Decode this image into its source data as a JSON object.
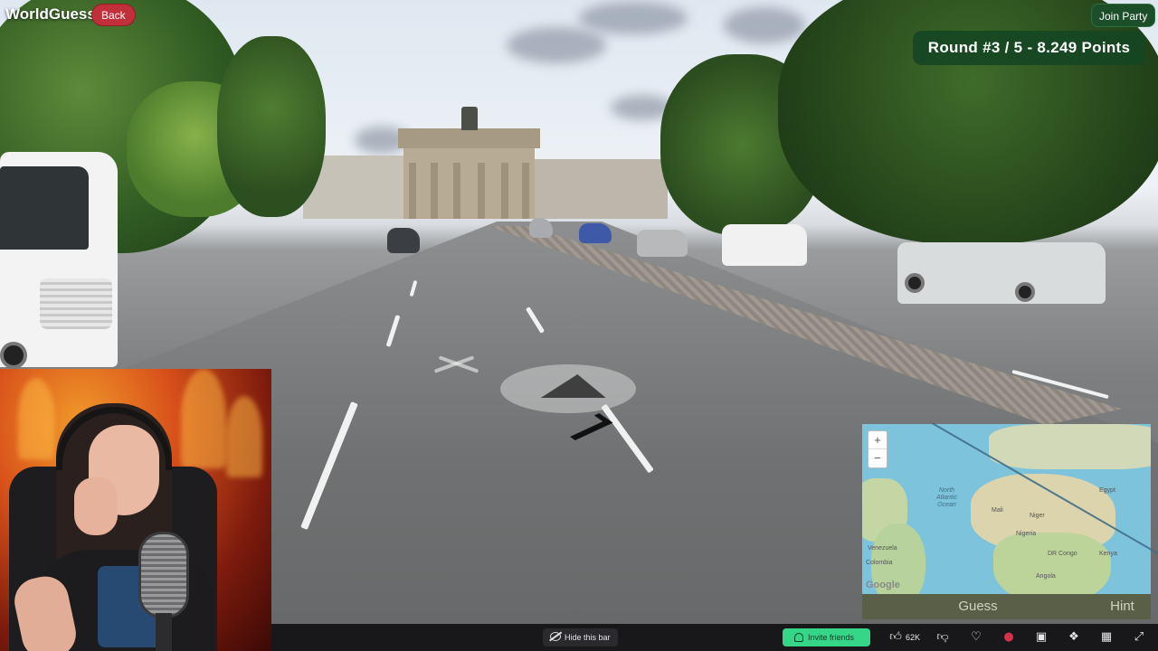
{
  "app": {
    "title": "WorldGuessr"
  },
  "header": {
    "back_label": "Back",
    "join_party_label": "Join Party",
    "round_status": "Round #3 / 5 - 8.249 Points"
  },
  "minimap": {
    "zoom_in": "+",
    "zoom_out": "−",
    "labels": {
      "ocean": "North\nAtlantic\nOcean",
      "venezuela": "Venezuela",
      "colombia": "Colombia",
      "mali": "Mali",
      "niger": "Niger",
      "nigeria": "Nigeria",
      "egypt": "Egypt",
      "drc": "DR Congo",
      "angola": "Angola",
      "kenya": "Kenya"
    },
    "attribution": "Google"
  },
  "actions": {
    "guess_label": "Guess",
    "hint_label": "Hint"
  },
  "bottom_bar": {
    "hide_label": "Hide this bar",
    "invite_label": "Invite friends",
    "like_count": "62K"
  },
  "icons": {
    "like": "thumbs-up-icon",
    "dislike": "thumbs-down-icon",
    "favorite": "heart-icon",
    "record": "record-icon",
    "chat": "chat-icon",
    "extensions": "puzzle-icon",
    "apps": "grid-icon",
    "fullscreen": "fullscreen-icon"
  },
  "colors": {
    "back_button": "#c1303a",
    "round_badge": "#14461f",
    "invite_button": "#35d688",
    "ocean": "#7ec3dc"
  }
}
